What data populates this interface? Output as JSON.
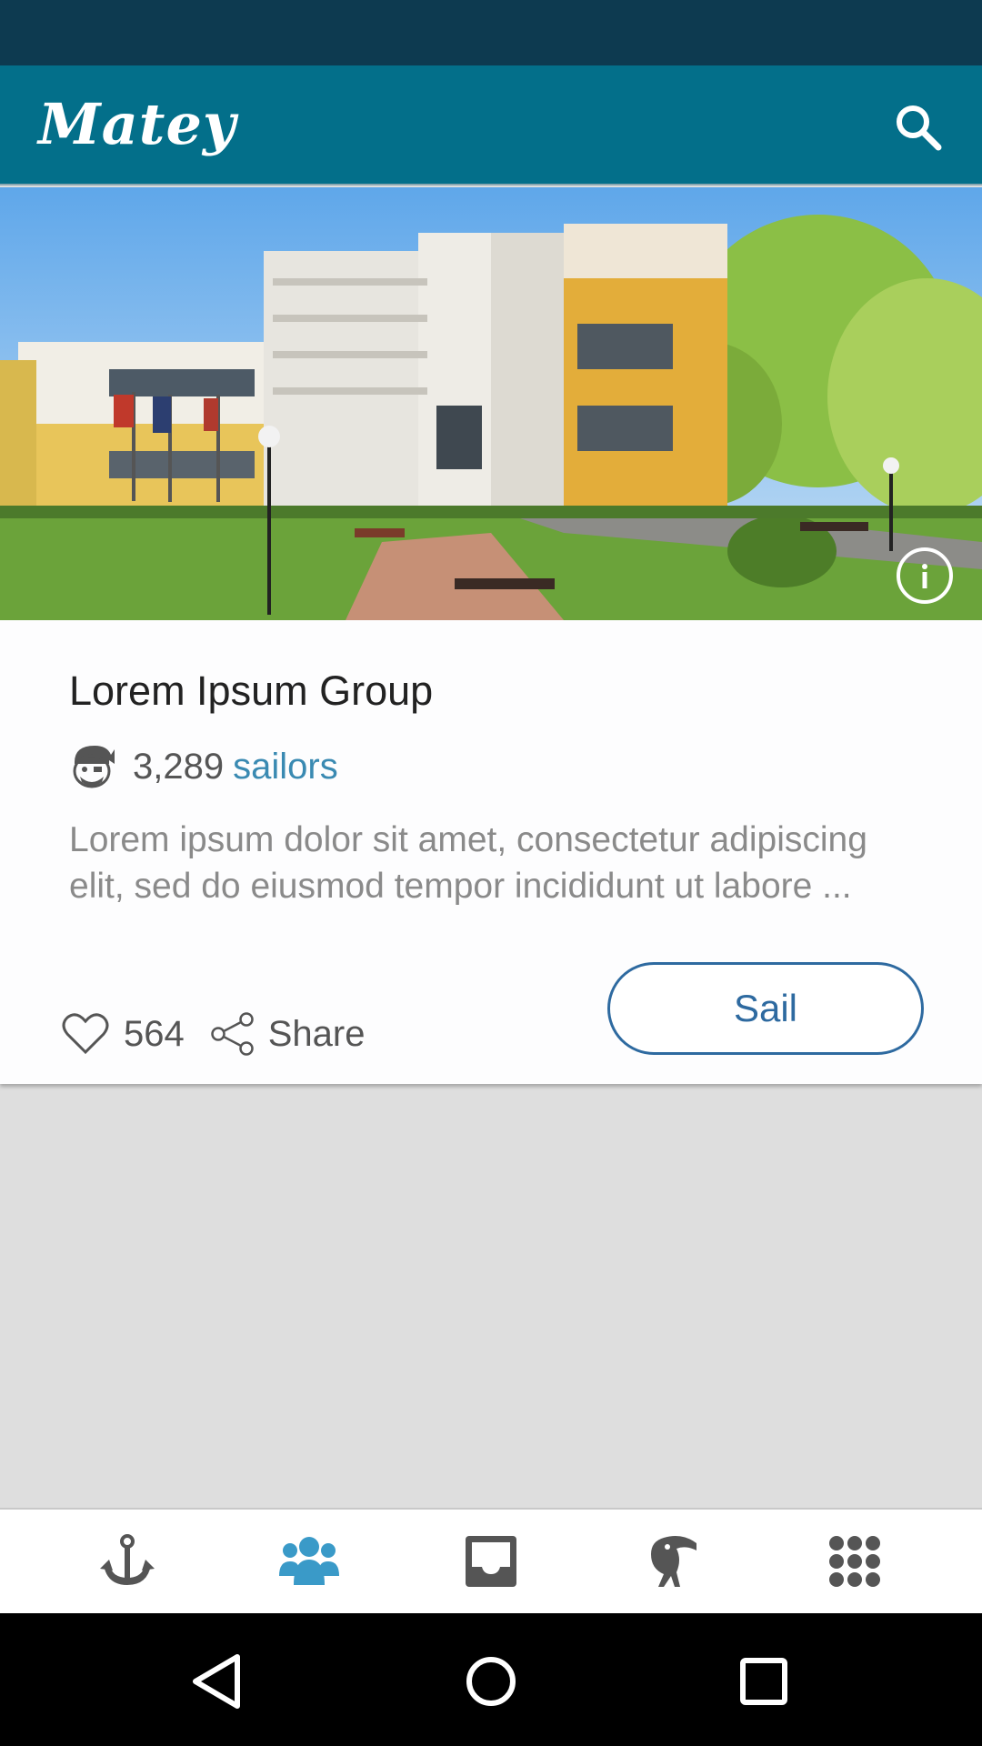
{
  "app": {
    "title": "Matey"
  },
  "card": {
    "title": "Lorem Ipsum Group",
    "members_count": "3,289",
    "members_unit": "sailors",
    "description": "Lorem ipsum dolor sit amet, consectetur adipiscing elit, sed do eiusmod tempor incididunt ut labore ...",
    "likes": "564",
    "share_label": "Share",
    "sail_label": "Sail"
  },
  "bottom_nav": {
    "items": [
      {
        "icon": "anchor-icon",
        "active": false
      },
      {
        "icon": "group-icon",
        "active": true
      },
      {
        "icon": "inbox-icon",
        "active": false
      },
      {
        "icon": "toucan-icon",
        "active": false
      },
      {
        "icon": "grid-apps-icon",
        "active": false
      }
    ]
  },
  "colors": {
    "status_bar": "#0d3a50",
    "app_bar": "#036f8a",
    "accent": "#3a8ab2",
    "button_outline": "#2e6aa0",
    "icon_inactive": "#555555",
    "icon_active": "#3a9ac8"
  }
}
